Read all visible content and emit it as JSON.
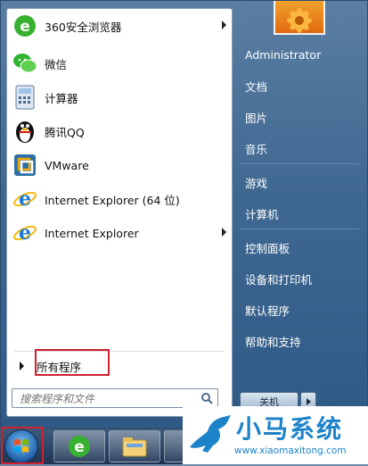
{
  "programs": [
    {
      "label": "360安全浏览器",
      "icon": "360-browser-icon",
      "has_arrow": true
    },
    {
      "label": "微信",
      "icon": "wechat-icon",
      "has_arrow": false
    },
    {
      "label": "计算器",
      "icon": "calculator-icon",
      "has_arrow": false
    },
    {
      "label": "腾讯QQ",
      "icon": "qq-penguin-icon",
      "has_arrow": false
    },
    {
      "label": "VMware",
      "icon": "vmware-icon",
      "has_arrow": false
    },
    {
      "label": "Internet Explorer (64 位)",
      "icon": "internet-explorer-icon",
      "has_arrow": false
    },
    {
      "label": "Internet Explorer",
      "icon": "internet-explorer-icon",
      "has_arrow": true
    }
  ],
  "all_programs": {
    "label": "所有程序"
  },
  "search": {
    "placeholder": "搜索程序和文件"
  },
  "right": {
    "user": "Administrator",
    "items": [
      "文档",
      "图片",
      "音乐",
      "游戏",
      "计算机",
      "控制面板",
      "设备和打印机",
      "默认程序",
      "帮助和支持"
    ]
  },
  "shutdown": {
    "label": "关机"
  },
  "watermark": {
    "title": "小马系统",
    "url": "www.xiaomaxitong.com"
  },
  "colors": {
    "highlight": "#d02030",
    "menu_blue": "#3f6891",
    "brand_blue": "#1d83c8"
  }
}
